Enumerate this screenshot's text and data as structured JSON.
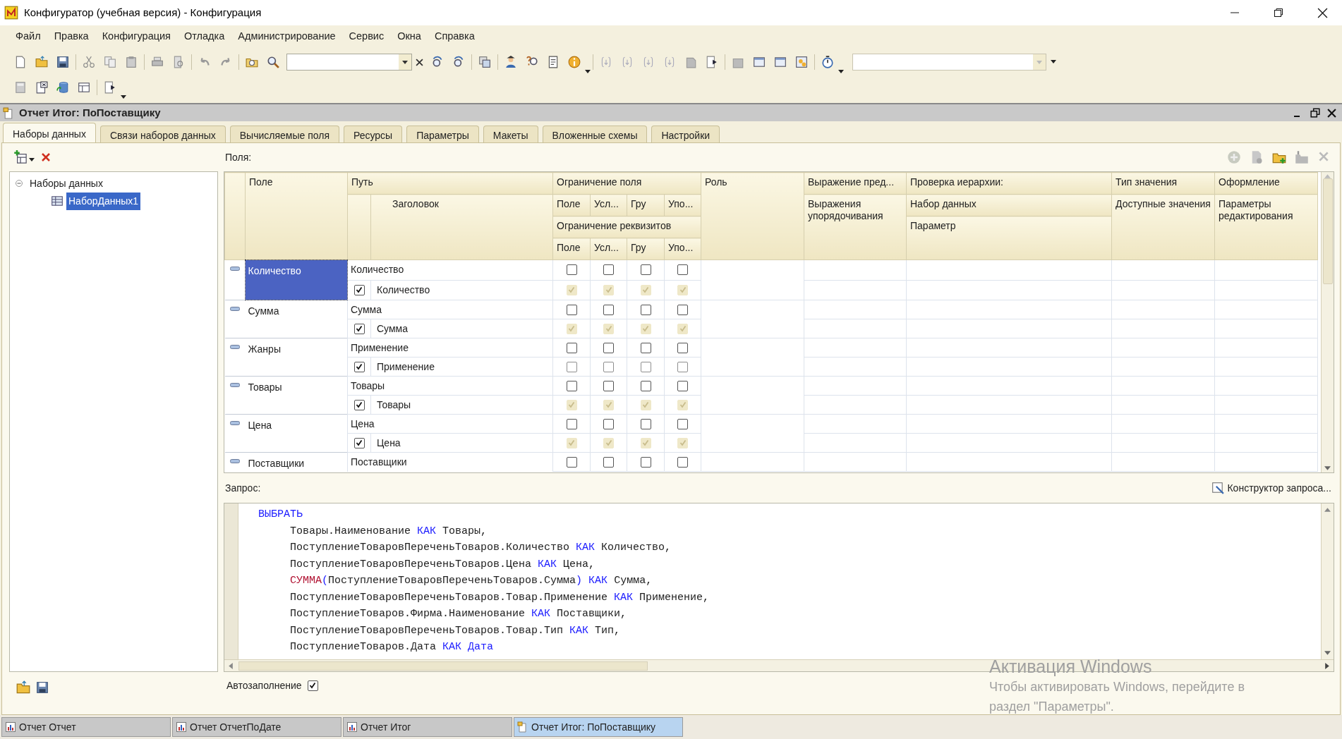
{
  "window": {
    "title": "Конфигуратор (учебная версия) - Конфигурация"
  },
  "menu": [
    "Файл",
    "Правка",
    "Конфигурация",
    "Отладка",
    "Администрирование",
    "Сервис",
    "Окна",
    "Справка"
  ],
  "document": {
    "title": "Отчет Итог: ПоПоставщику",
    "tabs": [
      {
        "label": "Наборы данных",
        "selected": true
      },
      {
        "label": "Связи наборов данных",
        "selected": false
      },
      {
        "label": "Вычисляемые поля",
        "selected": false
      },
      {
        "label": "Ресурсы",
        "selected": false
      },
      {
        "label": "Параметры",
        "selected": false
      },
      {
        "label": "Макеты",
        "selected": false
      },
      {
        "label": "Вложенные схемы",
        "selected": false
      },
      {
        "label": "Настройки",
        "selected": false
      }
    ],
    "tree": [
      {
        "label": "Наборы данных",
        "expanded": true,
        "selected": false,
        "children": [
          {
            "label": "НаборДанных1",
            "selected": true
          }
        ]
      }
    ],
    "fields_label": "Поля:",
    "columns": {
      "field": "Поле",
      "path": "Путь",
      "title": "Заголовок",
      "field_restriction": "Ограничение поля",
      "field_restriction_cols": [
        "Поле",
        "Усл...",
        "Гру",
        "Упо..."
      ],
      "attr_restriction": "Ограничение реквизитов",
      "attr_restriction_cols": [
        "Поле",
        "Усл...",
        "Гру",
        "Упо..."
      ],
      "role": "Роль",
      "presentation_expression": "Выражение пред...",
      "order_expression": "Выражения упорядочивания",
      "hierarchy_check": "Проверка иерархии:",
      "hierarchy_dataset": "Набор данных",
      "hierarchy_parameter": "Параметр",
      "value_type": "Тип значения",
      "available_values": "Доступные значения",
      "appearance": "Оформление",
      "edit_parameters": "Параметры редактирования"
    },
    "rows": [
      {
        "field": "Количество",
        "selected": true,
        "path": "Количество",
        "title": "Количество",
        "title_checked": true,
        "field_restrictions": [
          false,
          false,
          false,
          false
        ],
        "attr_restrictions": [
          true,
          true,
          true,
          true
        ]
      },
      {
        "field": "Сумма",
        "selected": false,
        "path": "Сумма",
        "title": "Сумма",
        "title_checked": true,
        "field_restrictions": [
          false,
          false,
          false,
          false
        ],
        "attr_restrictions": [
          true,
          true,
          true,
          true
        ]
      },
      {
        "field": "Жанры",
        "selected": false,
        "path": "Применение",
        "title": "Применение",
        "title_checked": true,
        "field_restrictions": [
          false,
          false,
          false,
          false
        ],
        "attr_restrictions": [
          false,
          false,
          false,
          false
        ]
      },
      {
        "field": "Товары",
        "selected": false,
        "path": "Товары",
        "title": "Товары",
        "title_checked": true,
        "field_restrictions": [
          false,
          false,
          false,
          false
        ],
        "attr_restrictions": [
          true,
          true,
          true,
          true
        ]
      },
      {
        "field": "Цена",
        "selected": false,
        "path": "Цена",
        "title": "Цена",
        "title_checked": true,
        "field_restrictions": [
          false,
          false,
          false,
          false
        ],
        "attr_restrictions": [
          true,
          true,
          true,
          true
        ]
      },
      {
        "field": "Поставщики",
        "selected": false,
        "path": "Поставщики",
        "field_restrictions": [
          false,
          false,
          false,
          false
        ]
      }
    ],
    "query_label": "Запрос:",
    "query_builder_button": "Конструктор запроса...",
    "query_lines": [
      {
        "kind": "clause",
        "tokens": [
          {
            "kind": "keyword",
            "text": "ВЫБРАТЬ"
          }
        ]
      },
      {
        "kind": "item",
        "tokens": [
          {
            "kind": "plain",
            "text": "Товары.Наименование "
          },
          {
            "kind": "keyword",
            "text": "КАК"
          },
          {
            "kind": "plain",
            "text": " Товары,"
          }
        ]
      },
      {
        "kind": "item",
        "tokens": [
          {
            "kind": "plain",
            "text": "ПоступлениеТоваровПереченьТоваров.Количество "
          },
          {
            "kind": "keyword",
            "text": "КАК"
          },
          {
            "kind": "plain",
            "text": " Количество,"
          }
        ]
      },
      {
        "kind": "item",
        "tokens": [
          {
            "kind": "plain",
            "text": "ПоступлениеТоваровПереченьТоваров.Цена "
          },
          {
            "kind": "keyword",
            "text": "КАК"
          },
          {
            "kind": "plain",
            "text": " Цена,"
          }
        ]
      },
      {
        "kind": "item",
        "tokens": [
          {
            "kind": "function",
            "text": "СУММА"
          },
          {
            "kind": "punct",
            "text": "("
          },
          {
            "kind": "plain",
            "text": "ПоступлениеТоваровПереченьТоваров.Сумма"
          },
          {
            "kind": "punct",
            "text": ") "
          },
          {
            "kind": "keyword",
            "text": "КАК"
          },
          {
            "kind": "plain",
            "text": " Сумма,"
          }
        ]
      },
      {
        "kind": "item",
        "tokens": [
          {
            "kind": "plain",
            "text": "ПоступлениеТоваровПереченьТоваров.Товар.Применение "
          },
          {
            "kind": "keyword",
            "text": "КАК"
          },
          {
            "kind": "plain",
            "text": " Применение,"
          }
        ]
      },
      {
        "kind": "item",
        "tokens": [
          {
            "kind": "plain",
            "text": "ПоступлениеТоваров.Фирма.Наименование "
          },
          {
            "kind": "keyword",
            "text": "КАК"
          },
          {
            "kind": "plain",
            "text": " Поставщики,"
          }
        ]
      },
      {
        "kind": "item",
        "tokens": [
          {
            "kind": "plain",
            "text": "ПоступлениеТоваровПереченьТоваров.Товар.Тип "
          },
          {
            "kind": "keyword",
            "text": "КАК"
          },
          {
            "kind": "plain",
            "text": " Тип,"
          }
        ]
      },
      {
        "kind": "item",
        "tokens": [
          {
            "kind": "plain",
            "text": "ПоступлениеТоваров.Дата "
          },
          {
            "kind": "keyword",
            "text": "КАК Дата"
          }
        ]
      }
    ],
    "autofill": {
      "label": "Автозаполнение",
      "checked": true
    }
  },
  "open_windows": [
    {
      "label": "Отчет Отчет",
      "selected": false
    },
    {
      "label": "Отчет ОтчетПоДате",
      "selected": false
    },
    {
      "label": "Отчет Итог",
      "selected": false
    },
    {
      "label": "Отчет Итог: ПоПоставщику",
      "selected": true
    }
  ],
  "activation_notice": {
    "title": "Активация Windows",
    "lines": [
      "Чтобы активировать Windows, перейдите в",
      "раздел \"Параметры\"."
    ]
  }
}
